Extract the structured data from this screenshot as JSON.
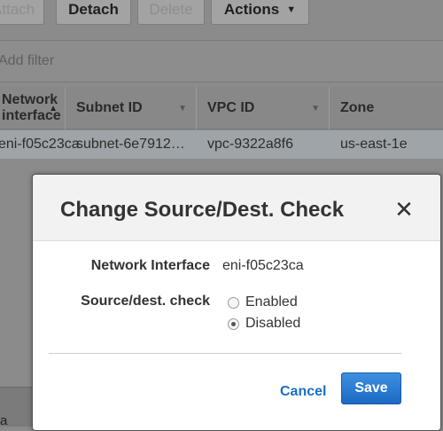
{
  "toolbar": {
    "attach_label": "Attach",
    "detach_label": "Detach",
    "delete_label": "Delete",
    "actions_label": "Actions",
    "actions_caret": "▼"
  },
  "filter": {
    "placeholder": "Add filter"
  },
  "table": {
    "columns": [
      {
        "label": "Network interface",
        "sort": "▲"
      },
      {
        "label": "Subnet ID",
        "sort": "▼"
      },
      {
        "label": "VPC ID",
        "sort": "▼"
      },
      {
        "label": "Zone",
        "sort": ""
      }
    ],
    "row": [
      "eni-f05c23ca",
      "subnet-6e7912…",
      "vpc-9322a8f6",
      "us-east-1e"
    ]
  },
  "bottom_partial_text": "a",
  "modal": {
    "title": "Change Source/Dest. Check",
    "close_glyph": "✕",
    "network_interface_label": "Network Interface",
    "network_interface_value": "eni-f05c23ca",
    "source_dest_label": "Source/dest. check",
    "options": [
      {
        "label": "Enabled",
        "checked": false
      },
      {
        "label": "Disabled",
        "checked": true
      }
    ],
    "cancel_label": "Cancel",
    "save_label": "Save"
  },
  "colors": {
    "link_blue": "#1a6ec4",
    "primary_button": "#2a7ad2"
  }
}
